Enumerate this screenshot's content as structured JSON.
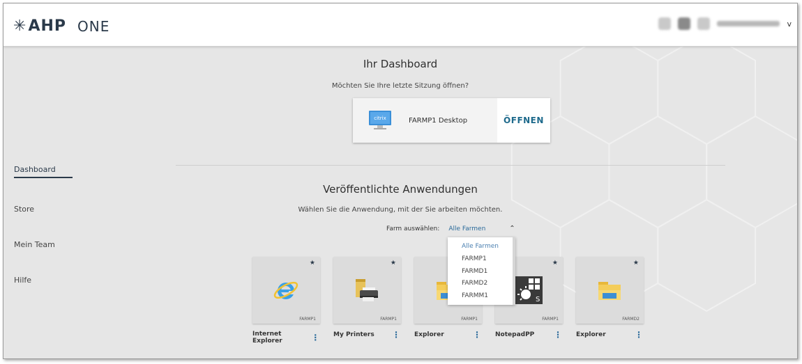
{
  "header": {
    "logo_text": "AHP",
    "product": "ONE",
    "user_chevron": "v"
  },
  "sidebar": {
    "items": [
      {
        "label": "Dashboard",
        "active": true
      },
      {
        "label": "Store"
      },
      {
        "label": "Mein Team"
      },
      {
        "label": "Hilfe"
      }
    ]
  },
  "dashboard": {
    "title": "Ihr Dashboard",
    "subtitle": "Möchten Sie Ihre letzte Sitzung öffnen?",
    "session": {
      "icon_label": "citrix",
      "name": "FARMP1 Desktop",
      "open_label": "ÖFFNEN"
    }
  },
  "apps_section": {
    "title": "Veröffentlichte Anwendungen",
    "subtitle": "Wählen Sie die Anwendung, mit der Sie arbeiten möchten.",
    "farm_label": "Farm auswählen:",
    "farm_value": "Alle Farmen",
    "farm_options": [
      "Alle Farmen",
      "FARMP1",
      "FARMD1",
      "FARMD2",
      "FARMM1"
    ]
  },
  "apps": [
    {
      "name": "Internet Explorer",
      "farm": "FARMP1",
      "icon": "internet-explorer-icon"
    },
    {
      "name": "My Printers",
      "farm": "FARMP1",
      "icon": "printer-icon"
    },
    {
      "name": "Explorer",
      "farm": "FARMP1",
      "icon": "folder-icon"
    },
    {
      "name": "NotepadPP",
      "farm": "FARMP1",
      "icon": "notepadpp-icon"
    },
    {
      "name": "Explorer",
      "farm": "FARMD2",
      "icon": "folder-icon"
    }
  ],
  "colors": {
    "accent": "#1e6a8c",
    "link": "#2a6a9a",
    "background": "#e6e6e6",
    "brand_dark": "#2b3a4a"
  }
}
